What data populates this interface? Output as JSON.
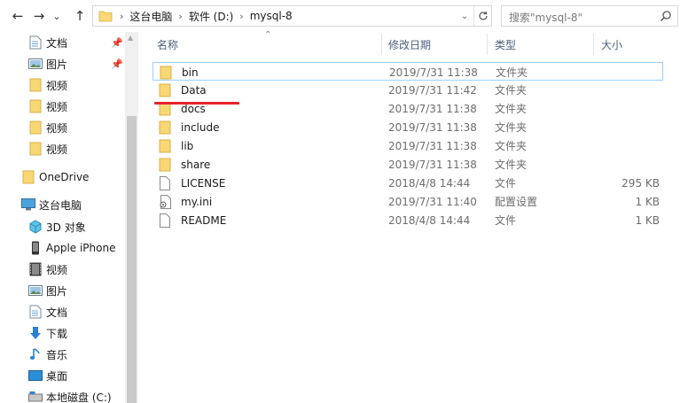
{
  "nav": {
    "back": "←",
    "forward": "→",
    "recent": "⌄",
    "up": "↑"
  },
  "address": {
    "crumbs": [
      "这台电脑",
      "软件 (D:)",
      "mysql-8"
    ],
    "separator": "›"
  },
  "search": {
    "placeholder": "搜索\"mysql-8\""
  },
  "sidebar": {
    "quick_access": [
      {
        "label": "文档",
        "icon": "document-icon",
        "pinned": true
      },
      {
        "label": "图片",
        "icon": "pictures-icon",
        "pinned": true
      },
      {
        "label": "视频",
        "icon": "folder-icon"
      },
      {
        "label": "视频",
        "icon": "folder-icon"
      },
      {
        "label": "视频",
        "icon": "folder-icon"
      },
      {
        "label": "视频",
        "icon": "folder-icon"
      }
    ],
    "onedrive": {
      "label": "OneDrive",
      "icon": "onedrive-folder-icon"
    },
    "this_pc": {
      "label": "这台电脑",
      "icon": "computer-icon"
    },
    "pc_items": [
      {
        "label": "3D 对象",
        "icon": "3d-objects-icon"
      },
      {
        "label": "Apple iPhone",
        "icon": "phone-icon"
      },
      {
        "label": "视频",
        "icon": "videos-icon"
      },
      {
        "label": "图片",
        "icon": "pictures-icon"
      },
      {
        "label": "文档",
        "icon": "document-icon"
      },
      {
        "label": "下载",
        "icon": "download-icon"
      },
      {
        "label": "音乐",
        "icon": "music-icon"
      },
      {
        "label": "桌面",
        "icon": "desktop-icon"
      },
      {
        "label": "本地磁盘 (C:)",
        "icon": "drive-icon"
      }
    ]
  },
  "columns": {
    "name": "名称",
    "date": "修改日期",
    "type": "类型",
    "size": "大小"
  },
  "files": [
    {
      "name": "bin",
      "date": "2019/7/31 11:38",
      "type": "文件夹",
      "size": "",
      "icon": "folder-icon",
      "selected": true
    },
    {
      "name": "Data",
      "date": "2019/7/31 11:42",
      "type": "文件夹",
      "size": "",
      "icon": "folder-icon"
    },
    {
      "name": "docs",
      "date": "2019/7/31 11:38",
      "type": "文件夹",
      "size": "",
      "icon": "folder-icon"
    },
    {
      "name": "include",
      "date": "2019/7/31 11:38",
      "type": "文件夹",
      "size": "",
      "icon": "folder-icon"
    },
    {
      "name": "lib",
      "date": "2019/7/31 11:38",
      "type": "文件夹",
      "size": "",
      "icon": "folder-icon"
    },
    {
      "name": "share",
      "date": "2019/7/31 11:38",
      "type": "文件夹",
      "size": "",
      "icon": "folder-icon"
    },
    {
      "name": "LICENSE",
      "date": "2018/4/8 14:44",
      "type": "文件",
      "size": "295 KB",
      "icon": "file-icon"
    },
    {
      "name": "my.ini",
      "date": "2019/7/31 11:40",
      "type": "配置设置",
      "size": "1 KB",
      "icon": "settings-file-icon"
    },
    {
      "name": "README",
      "date": "2018/4/8 14:44",
      "type": "文件",
      "size": "1 KB",
      "icon": "file-icon"
    }
  ],
  "colors": {
    "folder": "#f8d775",
    "selection_border": "#99d1ff",
    "annotation": "#e8222b",
    "header_text": "#4c607a"
  }
}
